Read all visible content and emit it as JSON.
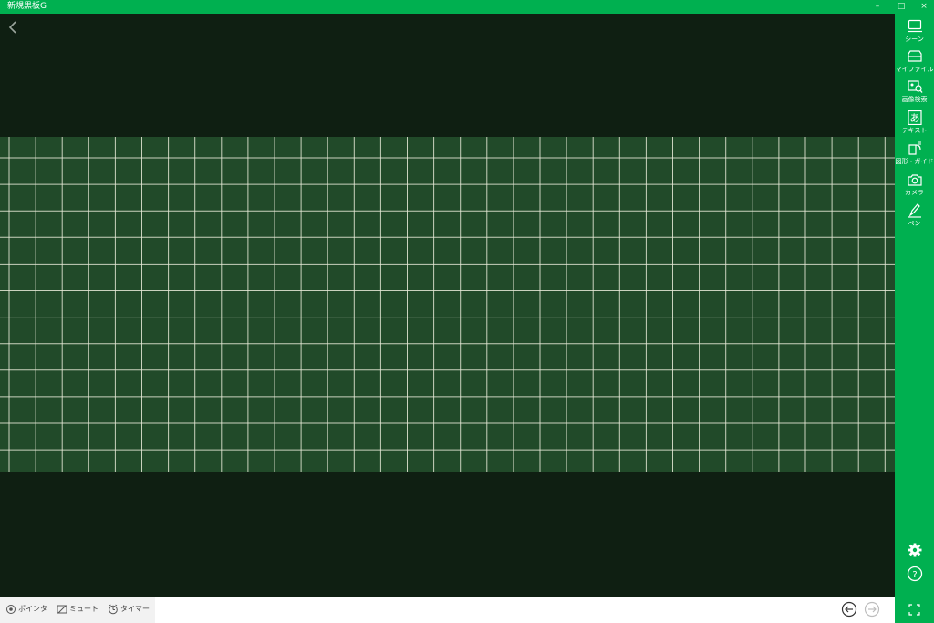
{
  "window": {
    "title": "新規黒板G",
    "minimize_glyph": "–",
    "maximize_glyph": "□",
    "close_glyph": "×"
  },
  "colors": {
    "accent": "#00b050",
    "background": "#0f1f12",
    "board": "#214a29",
    "grid": "#e8ead8"
  },
  "board": {
    "type": "grid",
    "columns": 33,
    "rows": 12
  },
  "toolbar": {
    "items": [
      {
        "id": "scene",
        "label": "シーン",
        "icon": "scene-icon"
      },
      {
        "id": "myfile",
        "label": "マイファイル",
        "icon": "folder-icon"
      },
      {
        "id": "image-search",
        "label": "画像検索",
        "icon": "image-search-icon"
      },
      {
        "id": "text",
        "label": "テキスト",
        "icon": "text-icon",
        "glyph": "あ"
      },
      {
        "id": "shape-guide",
        "label": "図形・ガイド",
        "icon": "shape-icon"
      },
      {
        "id": "camera",
        "label": "カメラ",
        "icon": "camera-icon"
      },
      {
        "id": "pen",
        "label": "ペン",
        "icon": "pen-icon"
      }
    ],
    "settings_icon": "gear-icon",
    "help_icon": "help-icon",
    "help_glyph": "?"
  },
  "statusbar": {
    "pointer_label": "ポインタ",
    "mute_label": "ミュート",
    "timer_label": "タイマー",
    "prev_icon": "arrow-left-circle-icon",
    "next_icon": "arrow-right-circle-icon"
  },
  "fullscreen_icon": "fullscreen-icon"
}
